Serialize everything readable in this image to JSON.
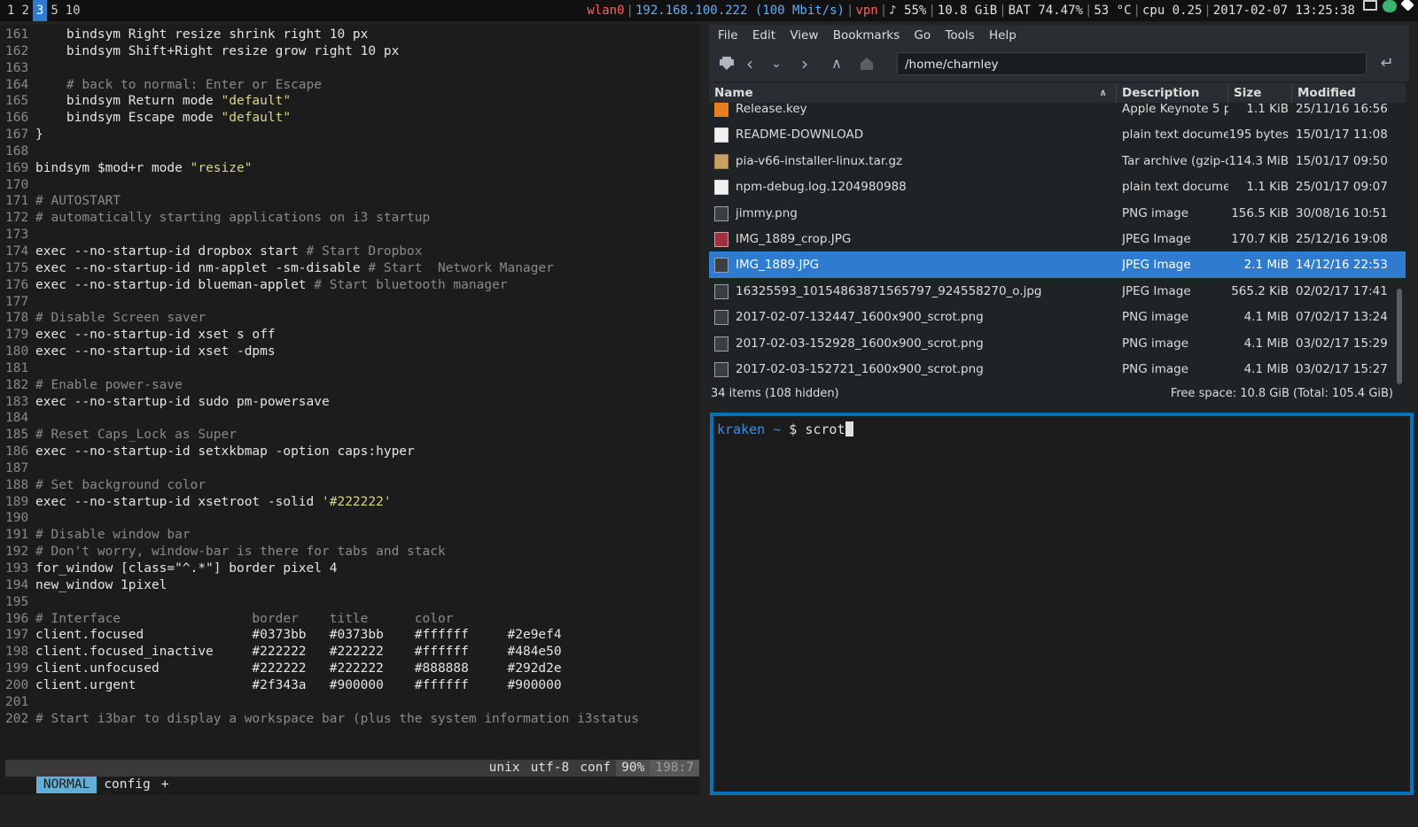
{
  "bar": {
    "workspaces": [
      {
        "label": "1",
        "active": false
      },
      {
        "label": "2",
        "active": false
      },
      {
        "label": "3",
        "active": true
      },
      {
        "label": "5",
        "active": false
      },
      {
        "label": "10",
        "active": false
      }
    ],
    "wlan": "wlan0",
    "ip": "192.168.100.222 (100 Mbit/s)",
    "vpn": "vpn",
    "volume": "♪ 55%",
    "disk": "10.8 GiB",
    "battery": "BAT 74.47%",
    "temp": "53 °C",
    "cpu": "cpu 0.25",
    "datetime": "2017-02-07 13:25:38",
    "colors": {
      "wlan": "#ff5f5f",
      "ip": "#5fafff",
      "vpn": "#ff5f5f",
      "accent": "#2e7bd0"
    }
  },
  "vim": {
    "lines": [
      {
        "n": "161",
        "parts": [
          {
            "t": "    bindsym Right resize shrink right 10 px",
            "c": "txt"
          }
        ]
      },
      {
        "n": "162",
        "parts": [
          {
            "t": "    bindsym Shift+Right resize grow right 10 px",
            "c": "txt"
          }
        ]
      },
      {
        "n": "163",
        "parts": []
      },
      {
        "n": "164",
        "parts": [
          {
            "t": "    # back to normal: Enter or Escape",
            "c": "cm"
          }
        ]
      },
      {
        "n": "165",
        "parts": [
          {
            "t": "    bindsym Return mode ",
            "c": "txt"
          },
          {
            "t": "\"default\"",
            "c": "str"
          }
        ]
      },
      {
        "n": "166",
        "parts": [
          {
            "t": "    bindsym Escape mode ",
            "c": "txt"
          },
          {
            "t": "\"default\"",
            "c": "str"
          }
        ]
      },
      {
        "n": "167",
        "parts": [
          {
            "t": "}",
            "c": "txt"
          }
        ]
      },
      {
        "n": "168",
        "parts": []
      },
      {
        "n": "169",
        "parts": [
          {
            "t": "bindsym $mod+r mode ",
            "c": "txt"
          },
          {
            "t": "\"resize\"",
            "c": "str"
          }
        ]
      },
      {
        "n": "170",
        "parts": []
      },
      {
        "n": "171",
        "parts": [
          {
            "t": "# AUTOSTART",
            "c": "cm"
          }
        ]
      },
      {
        "n": "172",
        "parts": [
          {
            "t": "# automatically starting applications on i3 startup",
            "c": "cm"
          }
        ]
      },
      {
        "n": "173",
        "parts": []
      },
      {
        "n": "174",
        "parts": [
          {
            "t": "exec --no-startup-id dropbox start ",
            "c": "txt"
          },
          {
            "t": "# Start Dropbox",
            "c": "cm"
          }
        ]
      },
      {
        "n": "175",
        "parts": [
          {
            "t": "exec --no-startup-id nm-applet -sm-disable ",
            "c": "txt"
          },
          {
            "t": "# Start  Network Manager",
            "c": "cm"
          }
        ]
      },
      {
        "n": "176",
        "parts": [
          {
            "t": "exec --no-startup-id blueman-applet ",
            "c": "txt"
          },
          {
            "t": "# Start bluetooth manager",
            "c": "cm"
          }
        ]
      },
      {
        "n": "177",
        "parts": []
      },
      {
        "n": "178",
        "parts": [
          {
            "t": "# Disable Screen saver",
            "c": "cm"
          }
        ]
      },
      {
        "n": "179",
        "parts": [
          {
            "t": "exec --no-startup-id xset s off",
            "c": "txt"
          }
        ]
      },
      {
        "n": "180",
        "parts": [
          {
            "t": "exec --no-startup-id xset -dpms",
            "c": "txt"
          }
        ]
      },
      {
        "n": "181",
        "parts": []
      },
      {
        "n": "182",
        "parts": [
          {
            "t": "# Enable power-save",
            "c": "cm"
          }
        ]
      },
      {
        "n": "183",
        "parts": [
          {
            "t": "exec --no-startup-id sudo pm-powersave",
            "c": "txt"
          }
        ]
      },
      {
        "n": "184",
        "parts": []
      },
      {
        "n": "185",
        "parts": [
          {
            "t": "# Reset Caps_Lock as Super",
            "c": "cm"
          }
        ]
      },
      {
        "n": "186",
        "parts": [
          {
            "t": "exec --no-startup-id setxkbmap -option caps:hyper",
            "c": "txt"
          }
        ]
      },
      {
        "n": "187",
        "parts": []
      },
      {
        "n": "188",
        "parts": [
          {
            "t": "# Set background color",
            "c": "cm"
          }
        ]
      },
      {
        "n": "189",
        "parts": [
          {
            "t": "exec --no-startup-id xsetroot -solid ",
            "c": "txt"
          },
          {
            "t": "'#222222'",
            "c": "str"
          }
        ]
      },
      {
        "n": "190",
        "parts": []
      },
      {
        "n": "191",
        "parts": [
          {
            "t": "# Disable window bar",
            "c": "cm"
          }
        ]
      },
      {
        "n": "192",
        "parts": [
          {
            "t": "# Don't worry, window-bar is there for tabs and stack",
            "c": "cm"
          }
        ]
      },
      {
        "n": "193",
        "parts": [
          {
            "t": "for_window [class=\"^.*\"] border pixel 4",
            "c": "txt"
          }
        ]
      },
      {
        "n": "194",
        "parts": [
          {
            "t": "new_window 1pixel",
            "c": "txt"
          }
        ]
      },
      {
        "n": "195",
        "parts": []
      },
      {
        "n": "196",
        "parts": [
          {
            "t": "# Interface                 border    title      color",
            "c": "cm"
          }
        ]
      },
      {
        "n": "197",
        "parts": [
          {
            "t": "client.focused              #0373bb   #0373bb    #ffffff     #2e9ef4",
            "c": "txt"
          }
        ]
      },
      {
        "n": "198",
        "parts": [
          {
            "t": "client.focused_inactive     #222222   #222222    #ffffff     #484e50",
            "c": "txt"
          }
        ]
      },
      {
        "n": "199",
        "parts": [
          {
            "t": "client.unfocused            #222222   #222222    #888888     #292d2e",
            "c": "txt"
          }
        ]
      },
      {
        "n": "200",
        "parts": [
          {
            "t": "client.urgent               #2f343a   #900000    #ffffff     #900000",
            "c": "txt"
          }
        ]
      },
      {
        "n": "201",
        "parts": []
      },
      {
        "n": "202",
        "parts": [
          {
            "t": "# Start i3bar to display a workspace bar (plus the system information i3status",
            "c": "cm"
          }
        ]
      }
    ],
    "statusline": {
      "mode": "NORMAL",
      "filename": "config",
      "modified": "+",
      "fileformat": "unix",
      "encoding": "utf-8",
      "filetype": "conf",
      "percent": "90%",
      "position": "198:7"
    }
  },
  "fm": {
    "menu": [
      "File",
      "Edit",
      "View",
      "Bookmarks",
      "Go",
      "Tools",
      "Help"
    ],
    "path": "/home/charnley",
    "columns": {
      "name": "Name",
      "description": "Description",
      "size": "Size",
      "modified": "Modified"
    },
    "files": [
      {
        "name": "Release.key",
        "desc": "Apple Keynote 5 pr",
        "size": "1.1 KiB",
        "modified": "25/11/16 16:56",
        "icon": "key-file-icon",
        "selected": false
      },
      {
        "name": "README-DOWNLOAD",
        "desc": "plain text documer",
        "size": "195 bytes",
        "modified": "15/01/17 11:08",
        "icon": "text-file-icon",
        "selected": false
      },
      {
        "name": "pia-v66-installer-linux.tar.gz",
        "desc": "Tar archive (gzip-cc",
        "size": "114.3 MiB",
        "modified": "15/01/17 09:50",
        "icon": "archive-icon",
        "selected": false
      },
      {
        "name": "npm-debug.log.1204980988",
        "desc": "plain text documer",
        "size": "1.1 KiB",
        "modified": "25/01/17 09:07",
        "icon": "text-file-icon",
        "selected": false
      },
      {
        "name": "jimmy.png",
        "desc": "PNG image",
        "size": "156.5 KiB",
        "modified": "30/08/16 10:51",
        "icon": "image-file-icon",
        "selected": false
      },
      {
        "name": "IMG_1889_crop.JPG",
        "desc": "JPEG Image",
        "size": "170.7 KiB",
        "modified": "25/12/16 19:08",
        "icon": "photo-thumbnail-icon",
        "selected": false
      },
      {
        "name": "IMG_1889.JPG",
        "desc": "JPEG Image",
        "size": "2.1 MiB",
        "modified": "14/12/16 22:53",
        "icon": "image-file-icon",
        "selected": true
      },
      {
        "name": "16325593_10154863871565797_924558270_o.jpg",
        "desc": "JPEG Image",
        "size": "565.2 KiB",
        "modified": "02/02/17 17:41",
        "icon": "image-file-icon",
        "selected": false
      },
      {
        "name": "2017-02-07-132447_1600x900_scrot.png",
        "desc": "PNG image",
        "size": "4.1 MiB",
        "modified": "07/02/17 13:24",
        "icon": "image-file-icon",
        "selected": false
      },
      {
        "name": "2017-02-03-152928_1600x900_scrot.png",
        "desc": "PNG image",
        "size": "4.1 MiB",
        "modified": "03/02/17 15:29",
        "icon": "image-file-icon",
        "selected": false
      },
      {
        "name": "2017-02-03-152721_1600x900_scrot.png",
        "desc": "PNG image",
        "size": "4.1 MiB",
        "modified": "03/02/17 15:27",
        "icon": "image-file-icon",
        "selected": false
      }
    ],
    "status_items": "34 items (108 hidden)",
    "status_free": "Free space: 10.8 GiB (Total: 105.4 GiB)"
  },
  "terminal": {
    "host": "kraken",
    "cwd": "~",
    "prompt_symbol": "$",
    "command": "scrot"
  }
}
